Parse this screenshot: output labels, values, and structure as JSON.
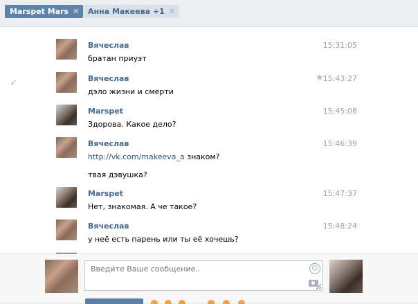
{
  "tabs": [
    {
      "label": "Marspet Mars",
      "close": "✖",
      "active": true
    },
    {
      "label": "Анна Макеева +1",
      "close": "✖",
      "active": false
    }
  ],
  "messages": [
    {
      "author": "Вячеслав",
      "time": "15:31:05",
      "lines": [
        "братан приуэт"
      ],
      "avatar": "vyacheslav"
    },
    {
      "author": "Вячеслав",
      "time": "15:43:27",
      "lines": [
        "дэло жизни и смерти"
      ],
      "avatar": "vyacheslav",
      "read_check": "✔",
      "star": "★"
    },
    {
      "author": "Marspet",
      "time": "15:45:08",
      "lines": [
        "Здорова. Какое дело?"
      ],
      "avatar": "marspet"
    },
    {
      "author": "Вячеслав",
      "time": "15:46:39",
      "link": "http://vk.com/makeeva_a",
      "link_suffix": " знаком?",
      "extra_line": "твая дэвушка?",
      "avatar": "vyacheslav"
    },
    {
      "author": "Marspet",
      "time": "15:47:37",
      "lines": [
        "Нет, знакомая. А че такое?"
      ],
      "avatar": "marspet"
    },
    {
      "author": "Вячеслав",
      "time": "15:48:24",
      "lines": [
        "у неё есть парень или ты её хочешь?"
      ],
      "avatar": "vyacheslav"
    }
  ],
  "composer": {
    "placeholder": "Введите Ваше сообщение..",
    "smile_icon": "smile-icon",
    "camera_icon": "camera-icon"
  },
  "colors": {
    "accent": "#5e82a8",
    "author": "#45688e",
    "link": "#2b587a"
  }
}
